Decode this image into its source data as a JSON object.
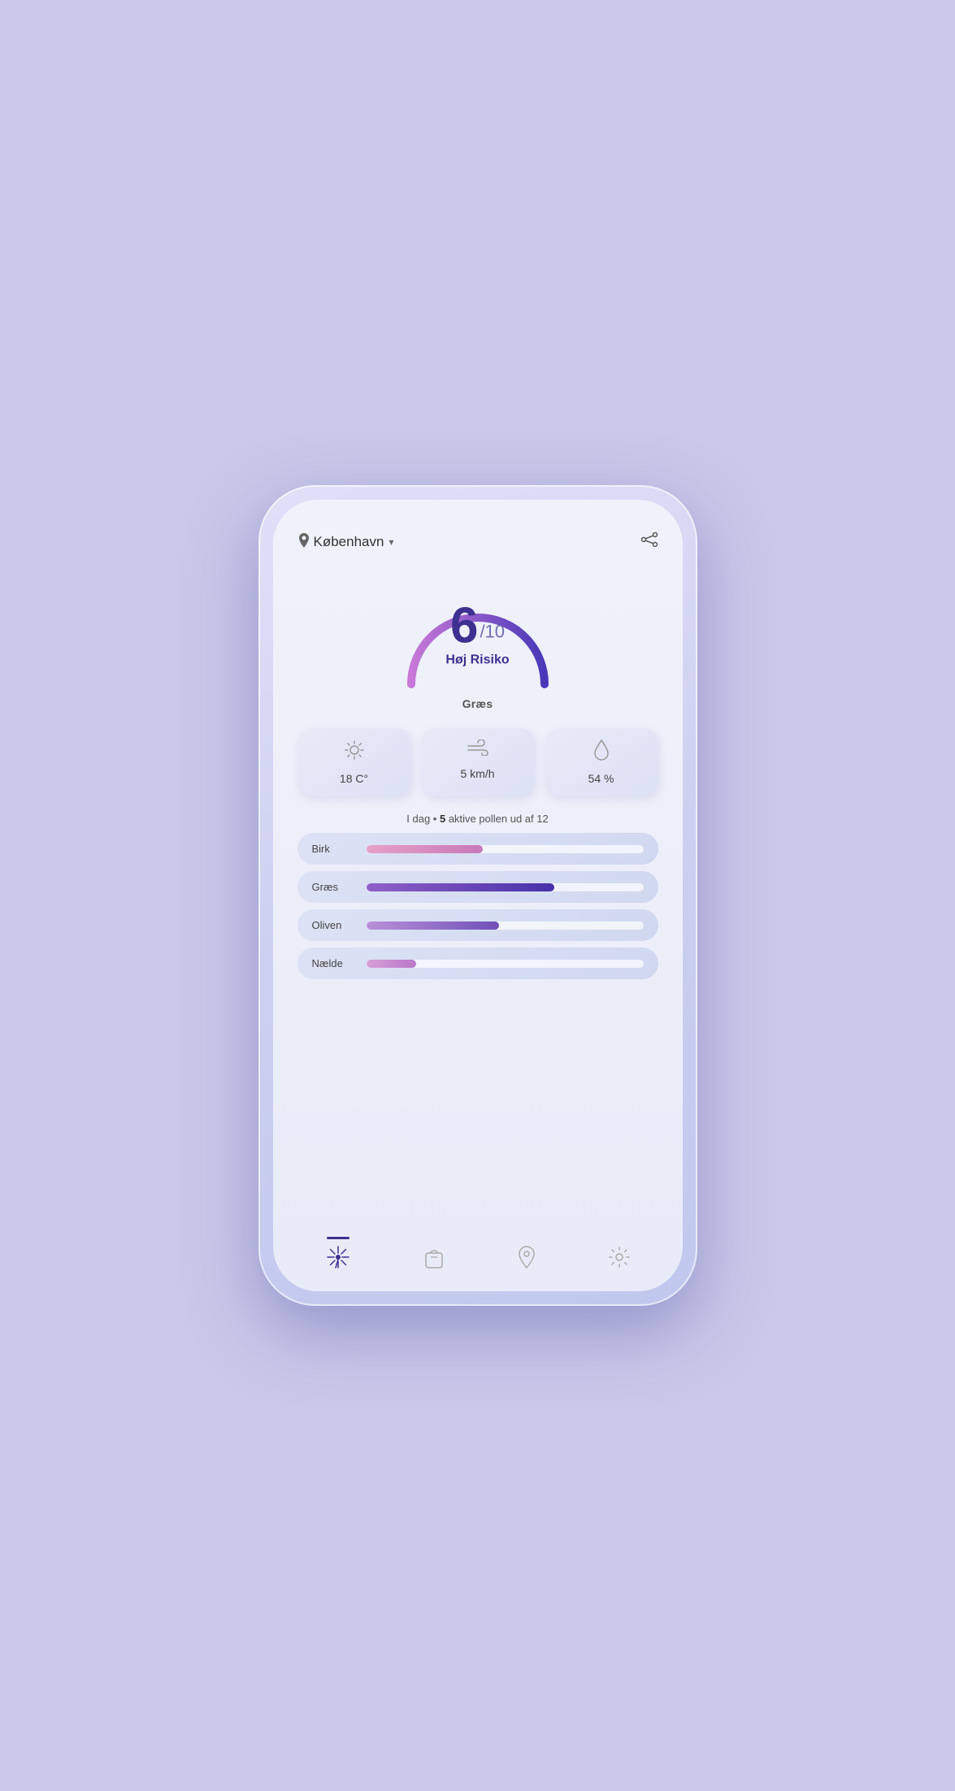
{
  "header": {
    "location_icon": "📍",
    "location_name": "København",
    "chevron": "▾",
    "share_icon": "share"
  },
  "gauge": {
    "score": "6",
    "denom": "/10",
    "risk_label": "Høj Risiko",
    "pollen_type": "Græs",
    "score_value": 6,
    "max_value": 10
  },
  "weather": [
    {
      "icon": "sun",
      "value": "18 C°"
    },
    {
      "icon": "wind",
      "value": "5 km/h"
    },
    {
      "icon": "drop",
      "value": "54 %"
    }
  ],
  "pollen_summary": {
    "prefix": "I dag • ",
    "count": "5",
    "suffix": " aktive pollen ud af 12"
  },
  "pollen_bars": [
    {
      "name": "Birk",
      "fill_pct": 42,
      "color_start": "#e8a0c8",
      "color_end": "#c878b8"
    },
    {
      "name": "Græs",
      "fill_pct": 68,
      "color_start": "#9060c8",
      "color_end": "#4830a8"
    },
    {
      "name": "Oliven",
      "fill_pct": 48,
      "color_start": "#b890d8",
      "color_end": "#7050b8"
    },
    {
      "name": "Nælde",
      "fill_pct": 18,
      "color_start": "#d8a0d8",
      "color_end": "#b878c8"
    }
  ],
  "nav": [
    {
      "icon": "dandelion",
      "label": "Home",
      "active": true
    },
    {
      "icon": "bag",
      "label": "Shop",
      "active": false
    },
    {
      "icon": "location",
      "label": "Location",
      "active": false
    },
    {
      "icon": "settings",
      "label": "Settings",
      "active": false
    }
  ]
}
